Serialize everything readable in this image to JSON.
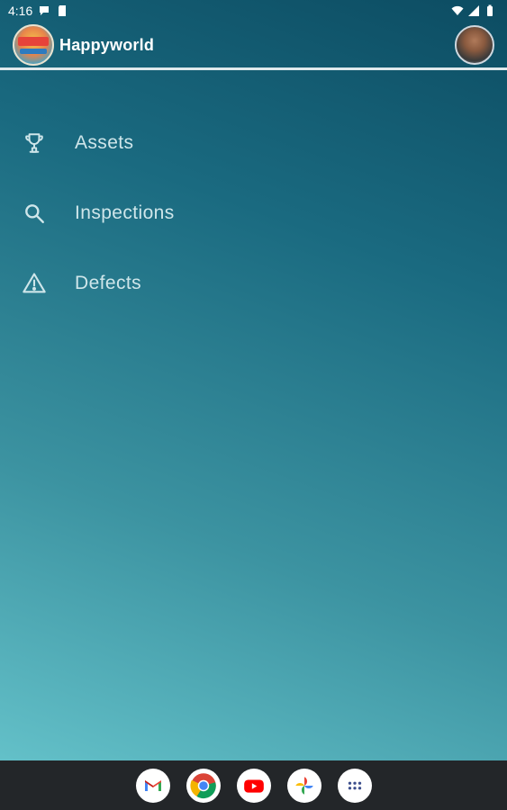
{
  "status_bar": {
    "time": "4:16",
    "icons": [
      "message-notification-icon",
      "sd-card-icon",
      "wifi-icon",
      "signal-icon",
      "battery-icon"
    ]
  },
  "app_bar": {
    "title": "Happyworld",
    "logo": "happyworld-logo",
    "avatar": "user-avatar"
  },
  "menu": {
    "items": [
      {
        "label": "Assets",
        "icon": "trophy-icon"
      },
      {
        "label": "Inspections",
        "icon": "search-icon"
      },
      {
        "label": "Defects",
        "icon": "warning-icon"
      }
    ]
  },
  "dock": {
    "apps": [
      "gmail-icon",
      "chrome-icon",
      "youtube-icon",
      "photos-icon",
      "app-drawer-icon"
    ]
  },
  "colors": {
    "menu_text": "#cfe6ea",
    "divider": "#dfe9ec",
    "dock_bg": "#232629"
  }
}
